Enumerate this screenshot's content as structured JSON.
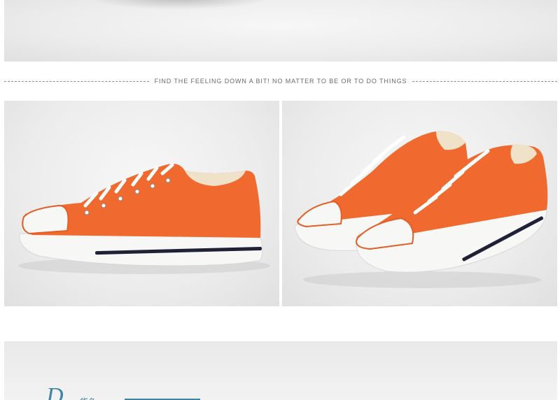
{
  "divider": {
    "tagline": "FIND THE FEELING DOWN A BIT! NO MATTER TO BE OR TO DO THINGS"
  },
  "photos": {
    "top": {
      "subject": "shoe-top-cropped"
    },
    "left": {
      "subject": "orange-canvas-sneaker-side"
    },
    "right": {
      "subject": "orange-canvas-sneaker-pair"
    },
    "bottom": {
      "subject": "brand-banner"
    }
  },
  "brand": {
    "mark": "D",
    "text": "货色"
  },
  "colors": {
    "shoe_orange": "#f0692f",
    "sole_white": "#f7f7f5",
    "stripe_navy": "#1f2236",
    "accent_blue": "#3f84a3"
  }
}
